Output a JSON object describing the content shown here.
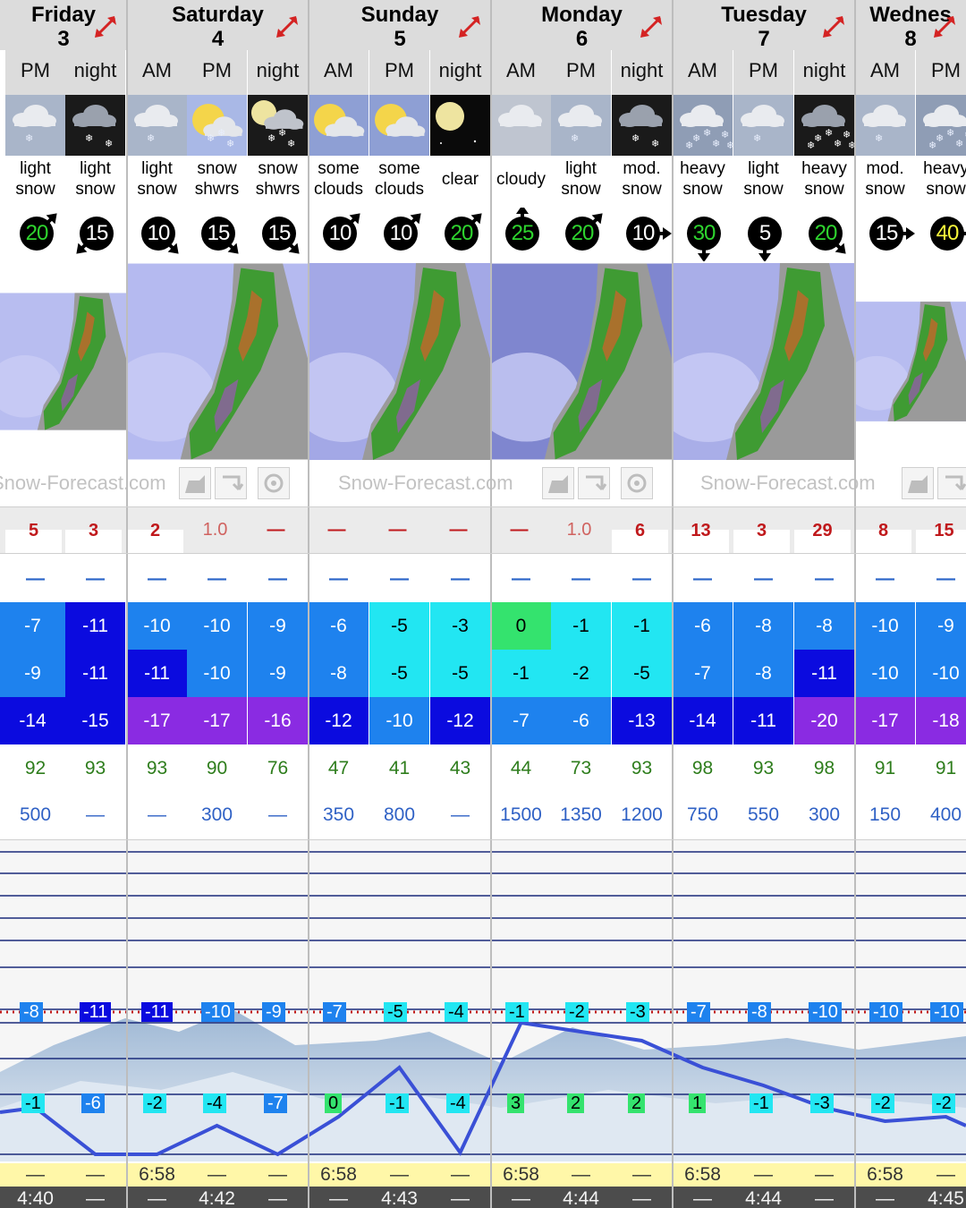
{
  "colors": {
    "header_bg": "#dcdcdc",
    "expand_arrow": "#d42323",
    "snow_text": "#c0191c",
    "rain_dash": "#2a64c8",
    "humidity_text": "#2e7d1c",
    "freezing_text": "#2f61c5",
    "temp_blue_dark": "#0b0bdf",
    "temp_blue": "#1e82ee",
    "temp_cyan": "#22e6f2",
    "temp_green": "#34e36e",
    "temp_purple": "#8a2be2",
    "sunrise_bg": "#fff7a8",
    "sunset_bg": "#4c4c4c",
    "wind_fill_green": "#2ed42e",
    "wind_fill_yellow": "#f7f73a",
    "line_blue": "#3a50d6"
  },
  "days": [
    {
      "name": "Friday",
      "num": "3",
      "expand_icon": "expand-arrow-icon"
    },
    {
      "name": "Saturday",
      "num": "4",
      "expand_icon": "expand-arrow-icon"
    },
    {
      "name": "Sunday",
      "num": "5",
      "expand_icon": "expand-arrow-icon"
    },
    {
      "name": "Monday",
      "num": "6",
      "expand_icon": "expand-arrow-icon"
    },
    {
      "name": "Tuesday",
      "num": "7",
      "expand_icon": "expand-arrow-icon"
    },
    {
      "name": "Wednes",
      "num": "8",
      "expand_icon": "expand-arrow-icon"
    }
  ],
  "periods": [
    {
      "label": "PM",
      "weather": "light\nsnow",
      "icon": "cloud-snow-icon",
      "wind": "20",
      "wind_color": "green",
      "wind_dir": "ne",
      "snow": "5",
      "rain": "—",
      "max": "-7",
      "min": "-9",
      "chill": "-14",
      "humid": "92",
      "freeze": "500",
      "fz_top": "-8",
      "fz_bot": "-1",
      "sunrise": "—",
      "sunset": "4:40"
    },
    {
      "label": "night",
      "weather": "light\nsnow",
      "icon": "cloud-snow-night-icon",
      "wind": "15",
      "wind_color": "white",
      "wind_dir": "sw",
      "snow": "3",
      "rain": "—",
      "max": "-11",
      "min": "-11",
      "chill": "-15",
      "humid": "93",
      "freeze": "—",
      "fz_top": "-11",
      "fz_bot": "-6",
      "sunrise": "—",
      "sunset": "—"
    },
    {
      "label": "AM",
      "weather": "light\nsnow",
      "icon": "cloud-snow-icon",
      "wind": "10",
      "wind_color": "white",
      "wind_dir": "se",
      "snow": "2",
      "rain": "—",
      "max": "-10",
      "min": "-11",
      "chill": "-17",
      "humid": "93",
      "freeze": "—",
      "fz_top": "-11",
      "fz_bot": "-2",
      "sunrise": "6:58",
      "sunset": "—"
    },
    {
      "label": "PM",
      "weather": "snow\nshwrs",
      "icon": "sun-cloud-snow-icon",
      "wind": "15",
      "wind_color": "white",
      "wind_dir": "se",
      "snow": "1.0",
      "rain": "—",
      "max": "-10",
      "min": "-10",
      "chill": "-17",
      "humid": "90",
      "freeze": "300",
      "fz_top": "-10",
      "fz_bot": "-4",
      "sunrise": "—",
      "sunset": "4:42"
    },
    {
      "label": "night",
      "weather": "snow\nshwrs",
      "icon": "moon-cloud-snow-icon",
      "wind": "15",
      "wind_color": "white",
      "wind_dir": "se",
      "snow": "—",
      "rain": "—",
      "max": "-9",
      "min": "-9",
      "chill": "-16",
      "humid": "76",
      "freeze": "—",
      "fz_top": "-9",
      "fz_bot": "-7",
      "sunrise": "—",
      "sunset": "—"
    },
    {
      "label": "AM",
      "weather": "some\nclouds",
      "icon": "sun-cloud-icon",
      "wind": "10",
      "wind_color": "white",
      "wind_dir": "ne",
      "snow": "—",
      "rain": "—",
      "max": "-6",
      "min": "-8",
      "chill": "-12",
      "humid": "47",
      "freeze": "350",
      "fz_top": "-7",
      "fz_bot": "0",
      "sunrise": "6:58",
      "sunset": "—"
    },
    {
      "label": "PM",
      "weather": "some\nclouds",
      "icon": "sun-cloud-icon",
      "wind": "10",
      "wind_color": "white",
      "wind_dir": "ne",
      "snow": "—",
      "rain": "—",
      "max": "-5",
      "min": "-5",
      "chill": "-10",
      "humid": "41",
      "freeze": "800",
      "fz_top": "-5",
      "fz_bot": "-1",
      "sunrise": "—",
      "sunset": "4:43"
    },
    {
      "label": "night",
      "weather": "clear",
      "icon": "moon-icon",
      "wind": "20",
      "wind_color": "green",
      "wind_dir": "ne",
      "snow": "—",
      "rain": "—",
      "max": "-3",
      "min": "-5",
      "chill": "-12",
      "humid": "43",
      "freeze": "—",
      "fz_top": "-4",
      "fz_bot": "-4",
      "sunrise": "—",
      "sunset": "—"
    },
    {
      "label": "AM",
      "weather": "cloudy",
      "icon": "cloud-icon",
      "wind": "25",
      "wind_color": "green",
      "wind_dir": "n",
      "snow": "—",
      "rain": "—",
      "max": "0",
      "min": "-1",
      "chill": "-7",
      "humid": "44",
      "freeze": "1500",
      "fz_top": "-1",
      "fz_bot": "3",
      "sunrise": "6:58",
      "sunset": "—"
    },
    {
      "label": "PM",
      "weather": "light\nsnow",
      "icon": "cloud-snow-icon",
      "wind": "20",
      "wind_color": "green",
      "wind_dir": "ne",
      "snow": "1.0",
      "rain": "—",
      "max": "-1",
      "min": "-2",
      "chill": "-6",
      "humid": "73",
      "freeze": "1350",
      "fz_top": "-2",
      "fz_bot": "2",
      "sunrise": "—",
      "sunset": "4:44"
    },
    {
      "label": "night",
      "weather": "mod.\nsnow",
      "icon": "cloud-snow-night-icon",
      "wind": "10",
      "wind_color": "white",
      "wind_dir": "e",
      "snow": "6",
      "rain": "—",
      "max": "-1",
      "min": "-5",
      "chill": "-13",
      "humid": "93",
      "freeze": "1200",
      "fz_top": "-3",
      "fz_bot": "2",
      "sunrise": "—",
      "sunset": "—"
    },
    {
      "label": "AM",
      "weather": "heavy\nsnow",
      "icon": "cloud-heavy-snow-icon",
      "wind": "30",
      "wind_color": "green",
      "wind_dir": "s",
      "snow": "13",
      "rain": "—",
      "max": "-6",
      "min": "-7",
      "chill": "-14",
      "humid": "98",
      "freeze": "750",
      "fz_top": "-7",
      "fz_bot": "1",
      "sunrise": "6:58",
      "sunset": "—"
    },
    {
      "label": "PM",
      "weather": "light\nsnow",
      "icon": "cloud-snow-icon",
      "wind": "5",
      "wind_color": "white",
      "wind_dir": "s",
      "snow": "3",
      "rain": "—",
      "max": "-8",
      "min": "-8",
      "chill": "-11",
      "humid": "93",
      "freeze": "550",
      "fz_top": "-8",
      "fz_bot": "-1",
      "sunrise": "—",
      "sunset": "4:44"
    },
    {
      "label": "night",
      "weather": "heavy\nsnow",
      "icon": "cloud-heavy-snow-night-icon",
      "wind": "20",
      "wind_color": "green",
      "wind_dir": "se",
      "snow": "29",
      "rain": "—",
      "max": "-8",
      "min": "-11",
      "chill": "-20",
      "humid": "98",
      "freeze": "300",
      "fz_top": "-10",
      "fz_bot": "-3",
      "sunrise": "—",
      "sunset": "—"
    },
    {
      "label": "AM",
      "weather": "mod.\nsnow",
      "icon": "cloud-snow-icon",
      "wind": "15",
      "wind_color": "white",
      "wind_dir": "e",
      "snow": "8",
      "rain": "—",
      "max": "-10",
      "min": "-10",
      "chill": "-17",
      "humid": "91",
      "freeze": "150",
      "fz_top": "-10",
      "fz_bot": "-2",
      "sunrise": "6:58",
      "sunset": "—"
    },
    {
      "label": "PM",
      "weather": "heavy\nsnow",
      "icon": "cloud-heavy-snow-icon",
      "wind": "40",
      "wind_color": "yellow",
      "wind_dir": "e",
      "snow": "15",
      "rain": "—",
      "max": "-9",
      "min": "-10",
      "chill": "-18",
      "humid": "91",
      "freeze": "400",
      "fz_top": "-10",
      "fz_bot": "-2",
      "sunrise": "—",
      "sunset": "4:45"
    }
  ],
  "watermarks": [
    "Snow-Forecast.com",
    "Snow-Forecast.com",
    "Snow-Forecast.com"
  ],
  "map_controls": [
    "map-prev-icon",
    "map-next-icon",
    "map-settings-icon"
  ]
}
